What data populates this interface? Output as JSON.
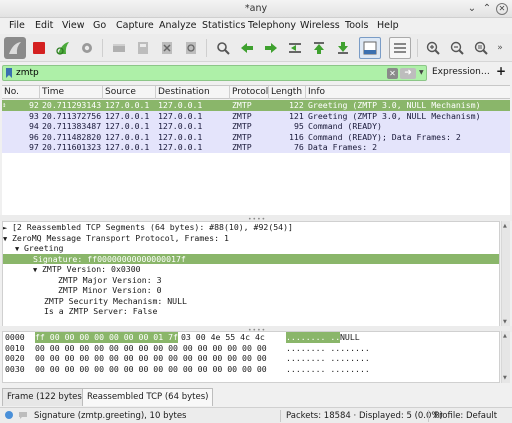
{
  "window": {
    "title": "*any"
  },
  "menu": [
    "File",
    "Edit",
    "View",
    "Go",
    "Capture",
    "Analyze",
    "Statistics",
    "Telephony",
    "Wireless",
    "Tools",
    "Help"
  ],
  "filter": {
    "value": "zmtp",
    "expression_label": "Expression…",
    "add_label": "+"
  },
  "columns": [
    "No.",
    "Time",
    "Source",
    "Destination",
    "Protocol",
    "Length",
    "Info"
  ],
  "packets": [
    {
      "no": "92",
      "time": "20.711293143",
      "src": "127.0.0.1",
      "dst": "127.0.0.1",
      "proto": "ZMTP",
      "len": "122",
      "info": "Greeting (ZMTP 3.0, NULL Mechanism)"
    },
    {
      "no": "93",
      "time": "20.711372756",
      "src": "127.0.0.1",
      "dst": "127.0.0.1",
      "proto": "ZMTP",
      "len": "121",
      "info": "Greeting (ZMTP 3.0, NULL Mechanism)"
    },
    {
      "no": "94",
      "time": "20.711383487",
      "src": "127.0.0.1",
      "dst": "127.0.0.1",
      "proto": "ZMTP",
      "len": "95",
      "info": "Command (READY)"
    },
    {
      "no": "96",
      "time": "20.711482820",
      "src": "127.0.0.1",
      "dst": "127.0.0.1",
      "proto": "ZMTP",
      "len": "116",
      "info": "Command (READY); Data Frames: 2"
    },
    {
      "no": "97",
      "time": "20.711601323",
      "src": "127.0.0.1",
      "dst": "127.0.0.1",
      "proto": "ZMTP",
      "len": "76",
      "info": "Data Frames: 2"
    }
  ],
  "details": [
    "[2 Reassembled TCP Segments (64 bytes): #88(10), #92(54)]",
    "ZeroMQ Message Transport Protocol, Frames: 1",
    "Greeting",
    "Signature: ff00000000000000017f",
    "ZMTP Version: 0x0300",
    "ZMTP Major Version: 3",
    "ZMTP Minor Version: 0",
    "ZMTP Security Mechanism: NULL",
    "Is a ZMTP Server: False"
  ],
  "hex": [
    {
      "offset": "0000",
      "bytes_hl": "ff 00 00 00 00 00 00 00  01 7f",
      "bytes_rest": " 03 00 4e 55 4c 4c",
      "ascii_hl": "........ ..",
      "ascii_rest": "NULL"
    },
    {
      "offset": "0010",
      "bytes_hl": "",
      "bytes_rest": "00 00 00 00 00 00 00 00  00 00 00 00 00 00 00 00",
      "ascii_hl": "",
      "ascii_rest": "........ ........"
    },
    {
      "offset": "0020",
      "bytes_hl": "",
      "bytes_rest": "00 00 00 00 00 00 00 00  00 00 00 00 00 00 00 00",
      "ascii_hl": "",
      "ascii_rest": "........ ........"
    },
    {
      "offset": "0030",
      "bytes_hl": "",
      "bytes_rest": "00 00 00 00 00 00 00 00  00 00 00 00 00 00 00 00",
      "ascii_hl": "",
      "ascii_rest": "........ ........"
    }
  ],
  "tabs": [
    "Frame (122 bytes)",
    "Reassembled TCP (64 bytes)"
  ],
  "status": {
    "field": "Signature (zmtp.greeting), 10 bytes",
    "packets": "Packets: 18584 · Displayed: 5 (0.0%)",
    "profile": "Profile: Default"
  },
  "colors": {
    "filter_ok": "#aef0a8",
    "selected_row": "#8ab66a",
    "zmtp_row": "#e4e4fb"
  }
}
